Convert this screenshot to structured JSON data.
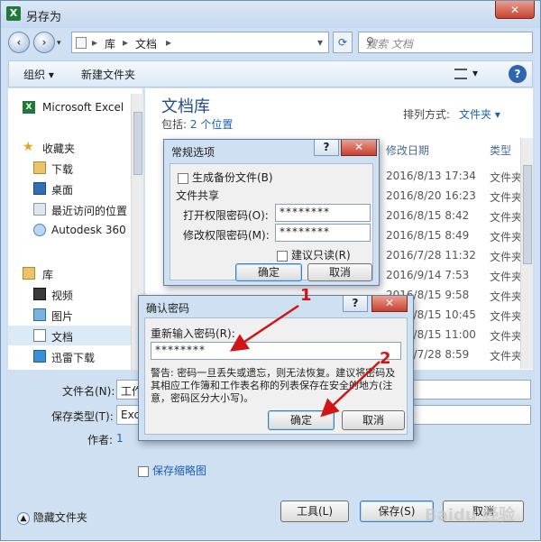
{
  "window": {
    "title": "另存为",
    "app_icon": "X",
    "close_glyph": "✕"
  },
  "address": {
    "path": [
      "库",
      "文档"
    ],
    "separator": "▸",
    "search_placeholder": "搜索 文档"
  },
  "toolbar": {
    "organize": "组织 ▾",
    "new_folder": "新建文件夹",
    "help": "?"
  },
  "nav": {
    "items": [
      {
        "label": "Microsoft Excel",
        "icon": "excel-icon"
      },
      {
        "label": "收藏夹",
        "icon": "star-icon"
      },
      {
        "label": "下载",
        "icon": "download-folder-icon"
      },
      {
        "label": "桌面",
        "icon": "desktop-icon"
      },
      {
        "label": "最近访问的位置",
        "icon": "recent-places-icon"
      },
      {
        "label": "Autodesk 360",
        "icon": "cloud-icon"
      },
      {
        "label": "库",
        "icon": "library-icon"
      },
      {
        "label": "视频",
        "icon": "video-icon"
      },
      {
        "label": "图片",
        "icon": "picture-icon"
      },
      {
        "label": "文档",
        "icon": "document-icon"
      },
      {
        "label": "迅雷下载",
        "icon": "thunder-icon"
      }
    ]
  },
  "content": {
    "library_title": "文档库",
    "includes_label": "包括:",
    "includes_link": "2 个位置",
    "sort_label": "排列方式:",
    "sort_value": "文件夹 ▾",
    "col_date": "修改日期",
    "col_type": "类型",
    "rows": [
      {
        "date": "2016/8/13 17:34",
        "type": "文件夹"
      },
      {
        "date": "2016/8/20 16:23",
        "type": "文件夹"
      },
      {
        "date": "2016/8/15 8:42",
        "type": "文件夹"
      },
      {
        "date": "2016/8/15 8:49",
        "type": "文件夹"
      },
      {
        "date": "2016/7/28 11:32",
        "type": "文件夹"
      },
      {
        "date": "2016/9/14 7:53",
        "type": "文件夹"
      },
      {
        "date": "2016/8/15 9:58",
        "type": "文件夹"
      },
      {
        "date": "2016/8/15 10:45",
        "type": "文件夹"
      },
      {
        "date": "2016/8/15 11:00",
        "type": "文件夹"
      },
      {
        "date": "2016/7/28 8:59",
        "type": "文件夹"
      }
    ]
  },
  "bottom": {
    "filename_label": "文件名(N):",
    "filename_value": "工作",
    "filetype_label": "保存类型(T):",
    "filetype_value": "Exc",
    "author_label": "作者:",
    "author_value": "1",
    "thumbnail_label": "保存缩略图",
    "hide_folders": "隐藏文件夹",
    "tools_button": "工具(L)",
    "save_button": "保存(S)",
    "cancel_button": "取消"
  },
  "general_options_dialog": {
    "title": "常规选项",
    "help": "?",
    "close": "✕",
    "backup_label": "生成备份文件(B)",
    "share_group": "文件共享",
    "open_pwd_label": "打开权限密码(O):",
    "open_pwd_value": "********",
    "modify_pwd_label": "修改权限密码(M):",
    "modify_pwd_value": "********",
    "readonly_label": "建议只读(R)",
    "ok": "确定",
    "cancel": "取消"
  },
  "confirm_dialog": {
    "title": "确认密码",
    "help": "?",
    "close": "✕",
    "reenter_label": "重新输入密码(R):",
    "password_value": "********",
    "warning": "警告: 密码一旦丢失或遗忘，则无法恢复。建议将密码及其相应工作簿和工作表名称的列表保存在安全的地方(注意，密码区分大小写)。",
    "ok": "确定",
    "cancel": "取消"
  },
  "annotations": {
    "marker_1": "1",
    "marker_2": "2",
    "color": "#d11414"
  },
  "watermark": "Baidu 经验"
}
